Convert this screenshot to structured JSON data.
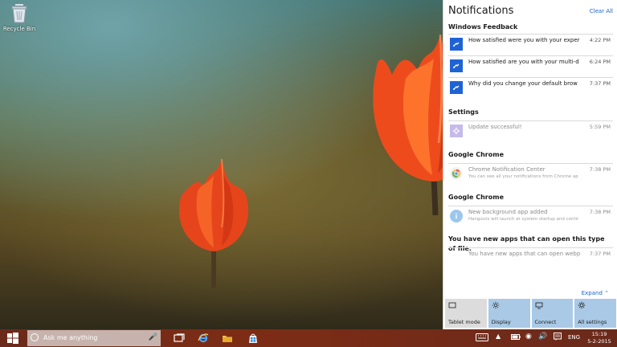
{
  "desktop": {
    "icons": [
      {
        "label": "Recycle Bin",
        "icon": "recycle-bin-icon"
      }
    ]
  },
  "action_center": {
    "title": "Notifications",
    "clear_all": "Clear All",
    "groups": [
      {
        "name": "Windows Feedback",
        "items": [
          {
            "title": "How satisfied were you with your exper",
            "time": "4:22 PM",
            "icon": "feedback-icon"
          },
          {
            "title": "How satisfied are you with your multi-d",
            "time": "6:24 PM",
            "icon": "feedback-icon"
          },
          {
            "title": "Why did you change your default brow",
            "time": "7:37 PM",
            "icon": "feedback-icon"
          }
        ]
      },
      {
        "name": "Settings",
        "items": [
          {
            "title": "Update successful!",
            "time": "5:59 PM",
            "icon": "settings-icon"
          }
        ]
      },
      {
        "name": "Google Chrome",
        "items": [
          {
            "title": "Chrome Notification Center",
            "subtitle": "You can see all your notifications from Chrome ap",
            "time": "7:38 PM",
            "icon": "chrome-icon"
          }
        ]
      },
      {
        "name": "Google Chrome",
        "items": [
          {
            "title": "New background app added",
            "subtitle": "Hangouts will launch at system startup and contir",
            "time": "7:38 PM",
            "icon": "info-icon"
          }
        ]
      },
      {
        "name": "You have new apps that can open this type of file.",
        "items": [
          {
            "title": "You have new apps that can open webp",
            "time": "7:37 PM",
            "icon": "none"
          }
        ]
      }
    ],
    "expand_label": "Expand",
    "quick_actions": [
      {
        "label": "Tablet mode",
        "state": "off",
        "icon": "tablet-mode-icon"
      },
      {
        "label": "Display",
        "state": "on",
        "icon": "brightness-icon"
      },
      {
        "label": "Connect",
        "state": "on",
        "icon": "connect-icon"
      },
      {
        "label": "All settings",
        "state": "on",
        "icon": "gear-icon"
      }
    ]
  },
  "taskbar": {
    "search_placeholder": "Ask me anything",
    "pinned_apps": [
      {
        "name": "Task View",
        "icon": "task-view-icon"
      },
      {
        "name": "Internet Explorer",
        "icon": "internet-explorer-icon"
      },
      {
        "name": "File Explorer",
        "icon": "file-explorer-icon"
      },
      {
        "name": "Store",
        "icon": "store-icon"
      }
    ],
    "tray": {
      "language": "ENG",
      "time": "15:19",
      "date": "5-2-2015"
    }
  },
  "colors": {
    "taskbar": "#7d2c15",
    "accent_blue": "#1e63d6",
    "quick_action_on": "#a9c9e6",
    "quick_action_off": "#dcdcdc"
  }
}
